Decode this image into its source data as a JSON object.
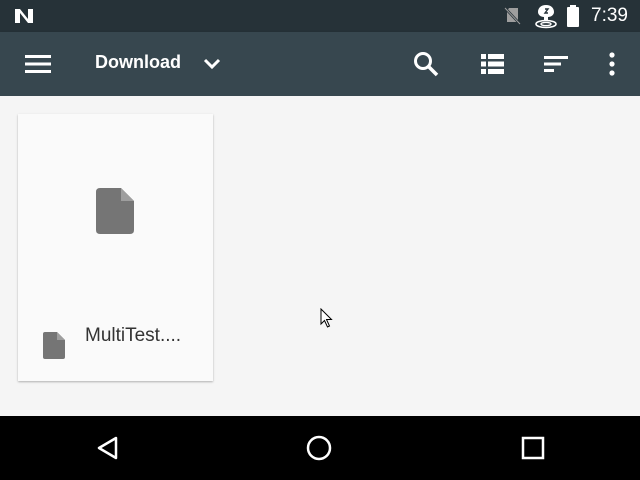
{
  "status_bar": {
    "time": "7:39",
    "icons": [
      "android-n-logo-icon",
      "no-sim-icon",
      "hotspot-icon",
      "battery-icon"
    ]
  },
  "toolbar": {
    "title": "Download",
    "icons": [
      "menu-icon",
      "chevron-down-icon",
      "search-icon",
      "list-view-icon",
      "sort-icon",
      "more-vert-icon"
    ]
  },
  "files": [
    {
      "name": "MultiTest....",
      "icon": "file-icon"
    }
  ],
  "nav_bar": {
    "icons": [
      "back-icon",
      "home-icon",
      "recents-icon"
    ]
  },
  "colors": {
    "status_bar": "#263238",
    "toolbar": "#37474f",
    "background": "#f5f5f5",
    "card": "#fafafa",
    "file_icon": "#757575",
    "nav_bar": "#000000"
  }
}
